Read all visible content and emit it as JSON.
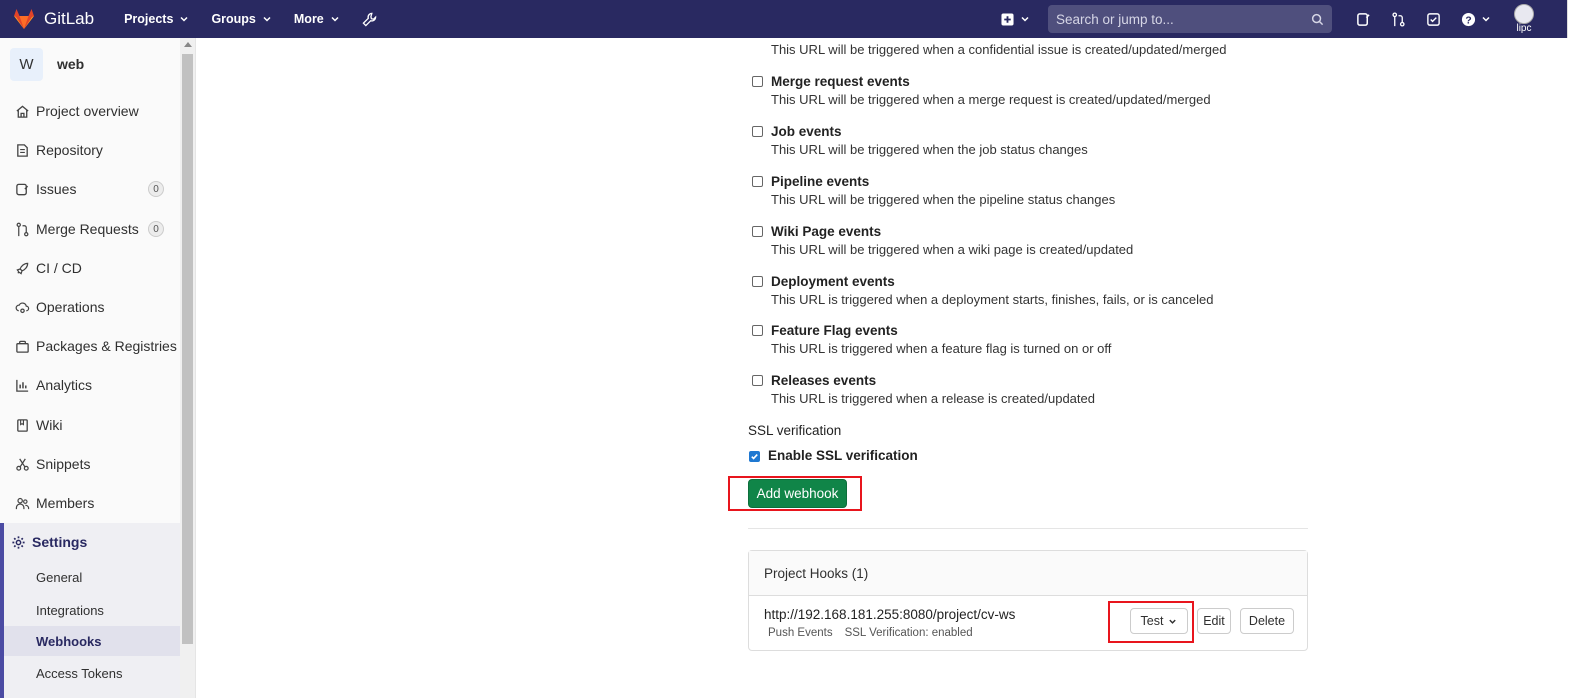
{
  "navbar": {
    "brand": "GitLab",
    "menu": [
      {
        "label": "Projects"
      },
      {
        "label": "Groups"
      },
      {
        "label": "More"
      }
    ],
    "search_placeholder": "Search or jump to...",
    "user_label": "lipc"
  },
  "sidebar": {
    "project_initial": "W",
    "project_name": "web",
    "items": [
      {
        "label": "Project overview",
        "icon": "home-icon"
      },
      {
        "label": "Repository",
        "icon": "doc-icon"
      },
      {
        "label": "Issues",
        "icon": "issues-icon",
        "count": "0"
      },
      {
        "label": "Merge Requests",
        "icon": "merge-request-icon",
        "count": "0"
      },
      {
        "label": "CI / CD",
        "icon": "rocket-icon"
      },
      {
        "label": "Operations",
        "icon": "cloud-gear-icon"
      },
      {
        "label": "Packages & Registries",
        "icon": "package-icon"
      },
      {
        "label": "Analytics",
        "icon": "chart-icon"
      },
      {
        "label": "Wiki",
        "icon": "book-icon"
      },
      {
        "label": "Snippets",
        "icon": "scissors-icon"
      },
      {
        "label": "Members",
        "icon": "users-icon"
      }
    ],
    "settings": {
      "label": "Settings",
      "subitems": [
        "General",
        "Integrations",
        "Webhooks",
        "Access Tokens"
      ],
      "active": "Webhooks"
    }
  },
  "main": {
    "partial_desc": "This URL will be triggered when a confidential issue is created/updated/merged",
    "events": [
      {
        "title": "Merge request events",
        "desc": "This URL will be triggered when a merge request is created/updated/merged",
        "checked": false
      },
      {
        "title": "Job events",
        "desc": "This URL will be triggered when the job status changes",
        "checked": false
      },
      {
        "title": "Pipeline events",
        "desc": "This URL will be triggered when the pipeline status changes",
        "checked": false
      },
      {
        "title": "Wiki Page events",
        "desc": "This URL will be triggered when a wiki page is created/updated",
        "checked": false
      },
      {
        "title": "Deployment events",
        "desc": "This URL is triggered when a deployment starts, finishes, fails, or is canceled",
        "checked": false
      },
      {
        "title": "Feature Flag events",
        "desc": "This URL is triggered when a feature flag is turned on or off",
        "checked": false
      },
      {
        "title": "Releases events",
        "desc": "This URL is triggered when a release is created/updated",
        "checked": false
      }
    ],
    "ssl_heading": "SSL verification",
    "ssl_checkbox_label": "Enable SSL verification",
    "ssl_checked": true,
    "add_button": "Add webhook",
    "hooks": {
      "header": "Project Hooks (1)",
      "url": "http://192.168.181.255:8080/project/cv-ws",
      "tags": [
        "Push Events",
        "SSL Verification: enabled"
      ],
      "test_label": "Test",
      "edit_label": "Edit",
      "delete_label": "Delete"
    }
  },
  "colors": {
    "navbar_bg": "#292961",
    "primary_button": "#108548",
    "highlight": "#e8151d"
  }
}
